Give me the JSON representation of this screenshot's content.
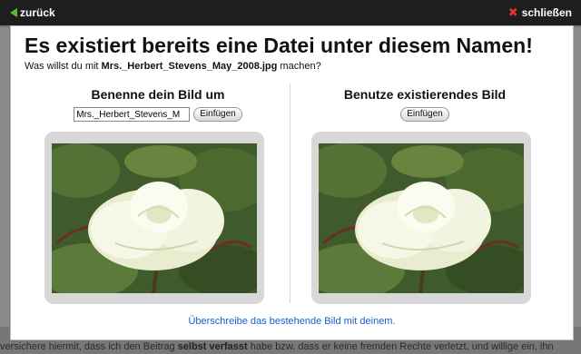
{
  "topbar": {
    "back_label": "zurück",
    "close_label": "schließen"
  },
  "dialog": {
    "title": "Es existiert bereits eine Datei unter diesem Namen!",
    "question_prefix": "Was willst du mit ",
    "filename": "Mrs._Herbert_Stevens_May_2008.jpg",
    "question_suffix": " machen?",
    "rename": {
      "heading": "Benenne dein Bild um",
      "input_value": "Mrs._Herbert_Stevens_M",
      "button_label": "Einfügen"
    },
    "existing": {
      "heading": "Benutze existierendes Bild",
      "button_label": "Einfügen"
    },
    "overwrite_link": "Überschreibe das bestehende Bild mit deinem."
  },
  "background": {
    "text_a": "versichere hiermit, dass ich den Beitrag ",
    "text_b": "selbst verfasst",
    "text_c": " habe bzw. dass er keine fremden Rechte verletzt, und willige ein, ihn"
  }
}
